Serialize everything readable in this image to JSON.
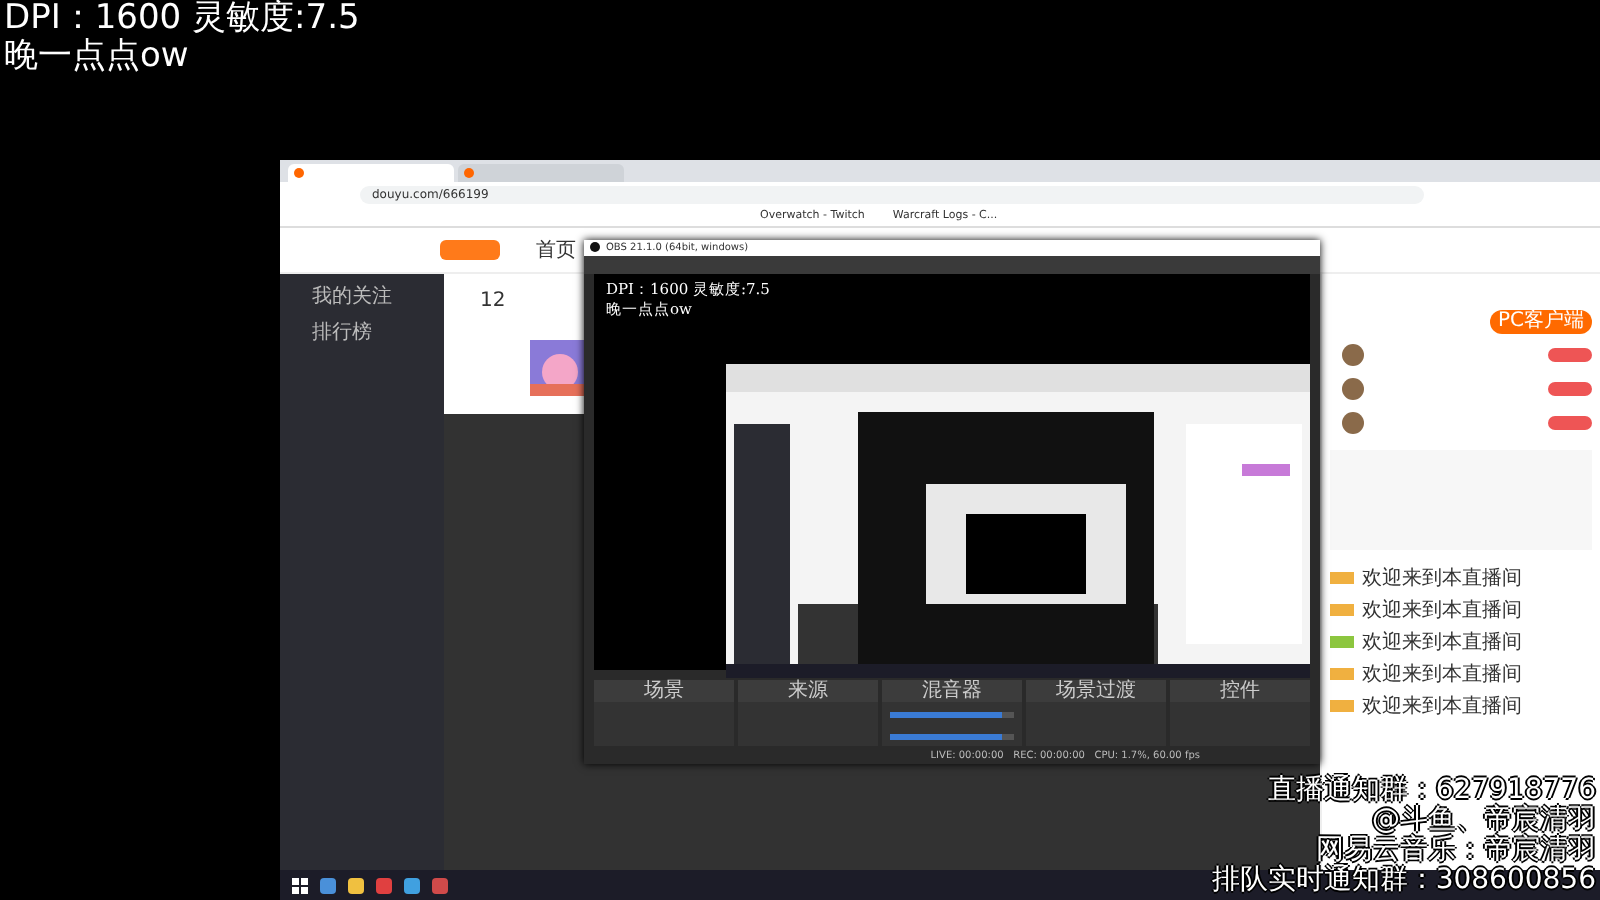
{
  "stream_overlay": {
    "lines": [
      "DPI：1600 灵敏度:7.5",
      "晚一点点ow"
    ]
  },
  "browser": {
    "tabs": [
      {
        "selected": true
      },
      {
        "selected": false
      }
    ],
    "address": "douyu.com/666199",
    "bookmarks": [
      "Overwatch - Twitch",
      "Warcraft Logs - C..."
    ]
  },
  "site": {
    "nav": "首页",
    "sidebar": [
      "我的关注",
      "排行榜"
    ],
    "stat": "12",
    "client_button": "PC客户端"
  },
  "obs": {
    "title": "OBS 21.1.0 (64bit, windows)",
    "preview_lines": [
      "DPI：1600 灵敏度:7.5",
      "晚一点点ow"
    ],
    "docks": [
      "场景",
      "来源",
      "混音器",
      "场景过渡",
      "控件"
    ],
    "mixer": [
      {
        "level": 0.9
      },
      {
        "level": 0.9
      }
    ],
    "status": "LIVE: 00:00:00   REC: 00:00:00   CPU: 1.7%, 60.00 fps"
  },
  "chat": {
    "welcome": [
      {
        "color": "#f0b040",
        "text": "欢迎来到本直播间"
      },
      {
        "color": "#f0b040",
        "text": "欢迎来到本直播间"
      },
      {
        "color": "#8cc63f",
        "text": "欢迎来到本直播间"
      },
      {
        "color": "#f0b040",
        "text": "欢迎来到本直播间"
      },
      {
        "color": "#f0b040",
        "text": "欢迎来到本直播间"
      }
    ]
  },
  "notices": [
    "直播通知群：627918776",
    "@斗鱼、帝宸清羽",
    "网易云音乐：帝宸清羽",
    "排队实时通知群：308600856"
  ]
}
